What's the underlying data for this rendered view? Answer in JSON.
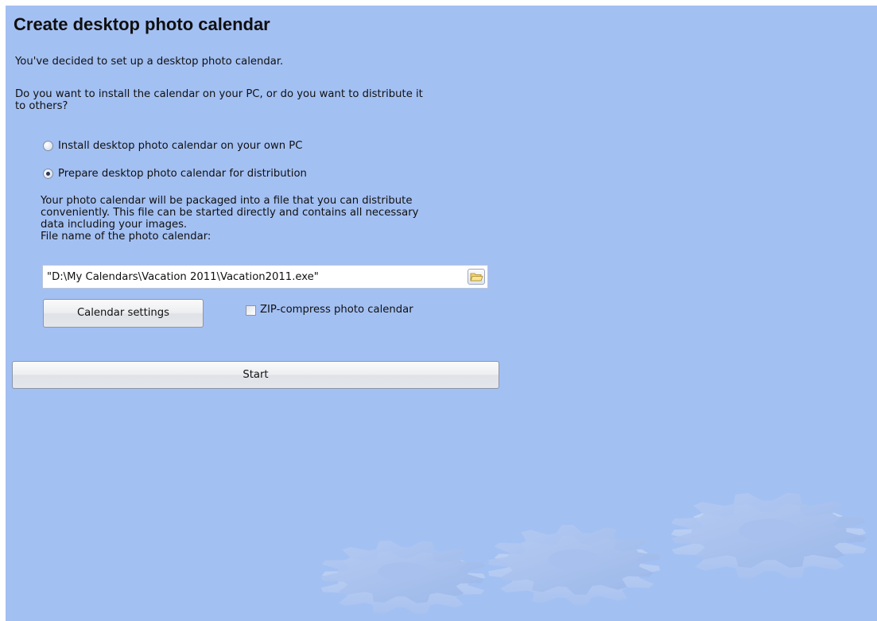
{
  "title": "Create desktop photo calendar",
  "intro": "You've decided to set up a desktop photo calendar.",
  "question_line1": "Do you want to install the calendar on your PC, or do you want to distribute it",
  "question_line2": "to others?",
  "options": [
    {
      "label": "Install desktop photo calendar on your own PC",
      "selected": false
    },
    {
      "label": "Prepare desktop photo calendar for distribution",
      "selected": true
    }
  ],
  "description": [
    "Your photo calendar will be packaged into a file that you can distribute",
    "conveniently. This file can be started directly and contains all necessary",
    "data including your images."
  ],
  "file_label": "File name of the photo calendar:",
  "file_value": "\"D:\\My Calendars\\Vacation 2011\\Vacation2011.exe\"",
  "calendar_settings_label": "Calendar settings",
  "zip_label": "ZIP-compress photo calendar",
  "zip_checked": false,
  "start_label": "Start",
  "icons": {
    "browse": "folder-icon",
    "decoration": "gears-illustration"
  },
  "colors": {
    "background": "#a3c0f3",
    "button": "#e9ebee"
  }
}
